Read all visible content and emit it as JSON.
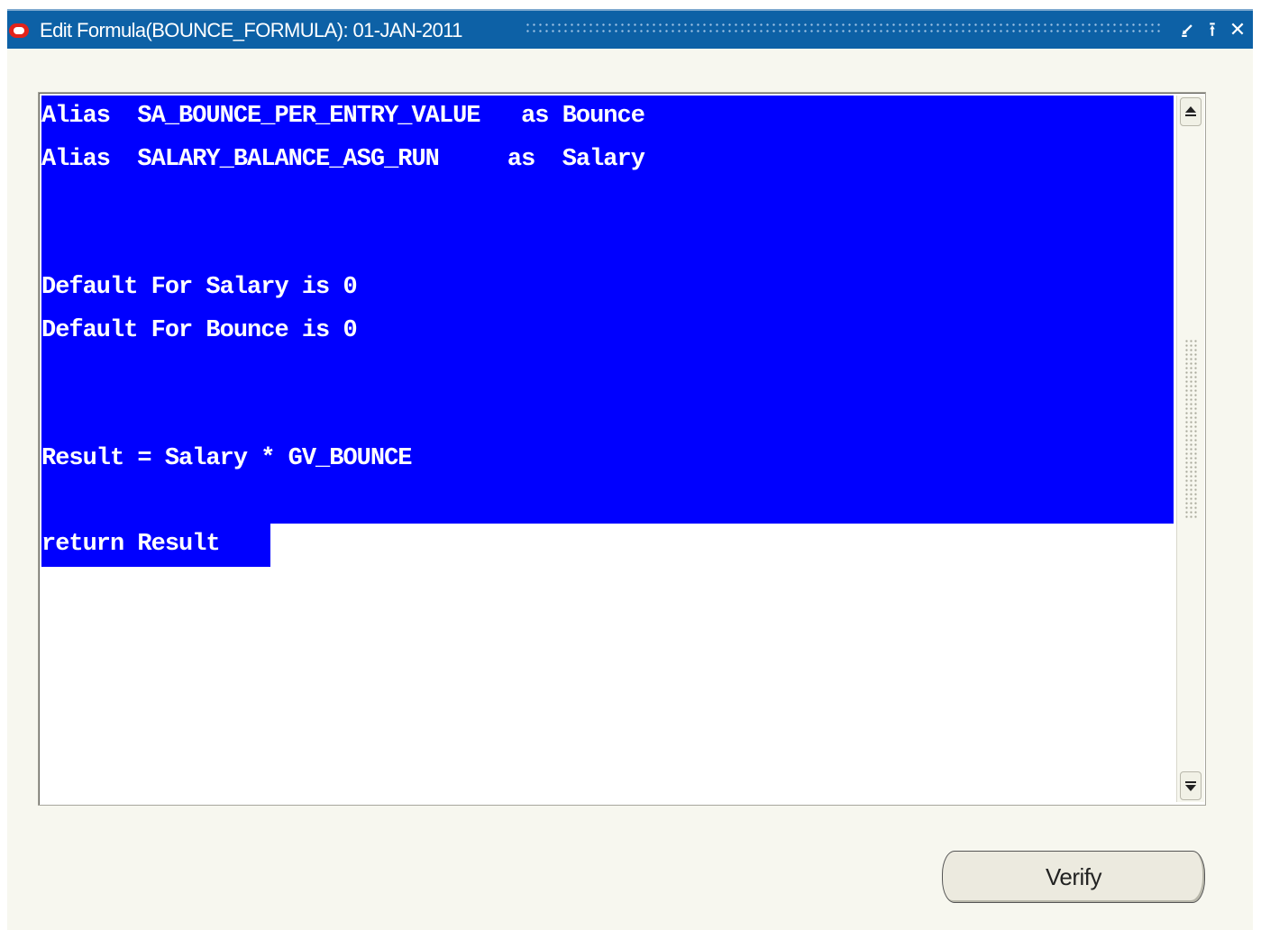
{
  "window": {
    "title": "Edit Formula(BOUNCE_FORMULA): 01-JAN-2011",
    "controls": {
      "minimize_icon": "minimize-icon",
      "maximize_icon": "maximize-icon",
      "close_icon": "close-icon",
      "minimize_glyph": "⭹",
      "maximize_glyph": "⭱",
      "close_glyph": "✕"
    }
  },
  "editor": {
    "lines": [
      "Alias  SA_BOUNCE_PER_ENTRY_VALUE   as Bounce",
      "Alias  SALARY_BALANCE_ASG_RUN     as  Salary",
      "",
      "",
      "Default For Salary is 0",
      "Default For Bounce is 0",
      "",
      "",
      "Result = Salary * GV_BOUNCE",
      "",
      "return Result"
    ],
    "selection_color": "#0000ff",
    "text_color": "#ffffff"
  },
  "actions": {
    "verify_label": "Verify"
  },
  "colors": {
    "titlebar": "#0d61a6",
    "window_bg": "#f7f7ef",
    "logo": "#e2231a"
  }
}
